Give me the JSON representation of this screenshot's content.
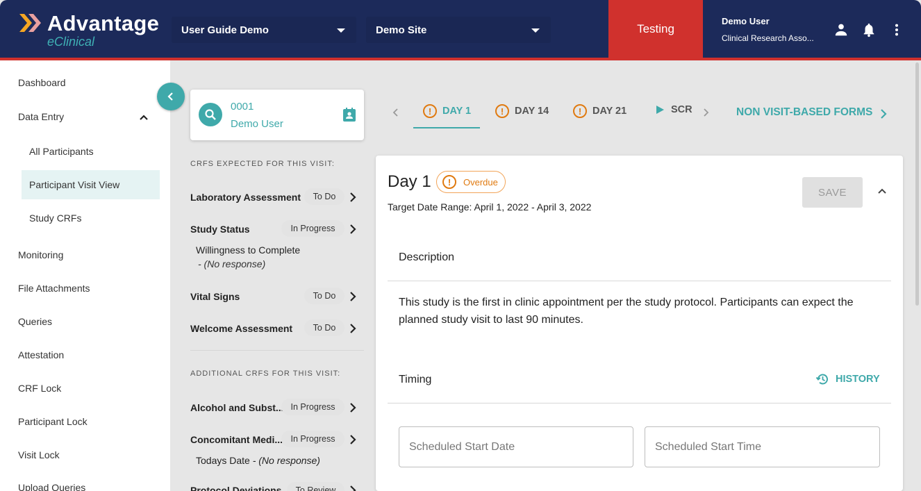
{
  "header": {
    "logo_title": "Advantage",
    "logo_subtitle": "eClinical",
    "study_select": "User Guide Demo",
    "site_select": "Demo Site",
    "environment": "Testing",
    "user_name": "Demo User",
    "user_role": "Clinical Research Asso...",
    "icons": [
      "person-icon",
      "bell-icon",
      "more-vert-icon"
    ],
    "colors": {
      "navy": "#1c2a5a",
      "accent": "#3fa9aa",
      "red": "#d0312d",
      "orange": "#e07a10"
    }
  },
  "sidebar": {
    "items": [
      {
        "label": "Dashboard"
      },
      {
        "label": "Data Entry"
      },
      {
        "label": "All Participants"
      },
      {
        "label": "Participant Visit View"
      },
      {
        "label": "Study CRFs"
      },
      {
        "label": "Monitoring"
      },
      {
        "label": "File Attachments"
      },
      {
        "label": "Queries"
      },
      {
        "label": "Attestation"
      },
      {
        "label": "CRF Lock"
      },
      {
        "label": "Participant Lock"
      },
      {
        "label": "Visit Lock"
      },
      {
        "label": "Upload Queries"
      }
    ]
  },
  "participant": {
    "id": "0001",
    "name": "Demo User"
  },
  "crfs": {
    "expected_label": "CRFS EXPECTED FOR THIS VISIT:",
    "expected": [
      {
        "name": "Laboratory Assessment",
        "status": "To Do"
      },
      {
        "name": "Study Status",
        "status": "In Progress",
        "detail": "Willingness to Complete",
        "detail_value": "- (No response)"
      },
      {
        "name": "Vital Signs",
        "status": "To Do"
      },
      {
        "name": "Welcome Assessment",
        "status": "To Do"
      }
    ],
    "additional_label": "ADDITIONAL CRFS FOR THIS VISIT:",
    "additional": [
      {
        "name": "Alcohol and Subst...",
        "status": "In Progress"
      },
      {
        "name": "Concomitant Medi...",
        "status": "In Progress",
        "detail": "Todays Date",
        "detail_value": "- (No response)"
      },
      {
        "name": "Protocol Deviations",
        "status": "To Review"
      }
    ]
  },
  "tabs": {
    "items": [
      {
        "label": "DAY 1"
      },
      {
        "label": "DAY 14"
      },
      {
        "label": "DAY 21"
      },
      {
        "label": "SCR"
      }
    ],
    "non_visit": "NON VISIT-BASED FORMS"
  },
  "visit": {
    "title": "Day 1",
    "status": "Overdue",
    "target_range": "Target Date Range: April 1, 2022 - April 3, 2022",
    "save_label": "SAVE",
    "description_title": "Description",
    "description": "This study is the first in clinic appointment per the study protocol. Participants can expect the planned study visit to last 90 minutes.",
    "timing_title": "Timing",
    "history_label": "HISTORY",
    "start_date_placeholder": "Scheduled Start Date",
    "start_time_placeholder": "Scheduled Start Time"
  }
}
